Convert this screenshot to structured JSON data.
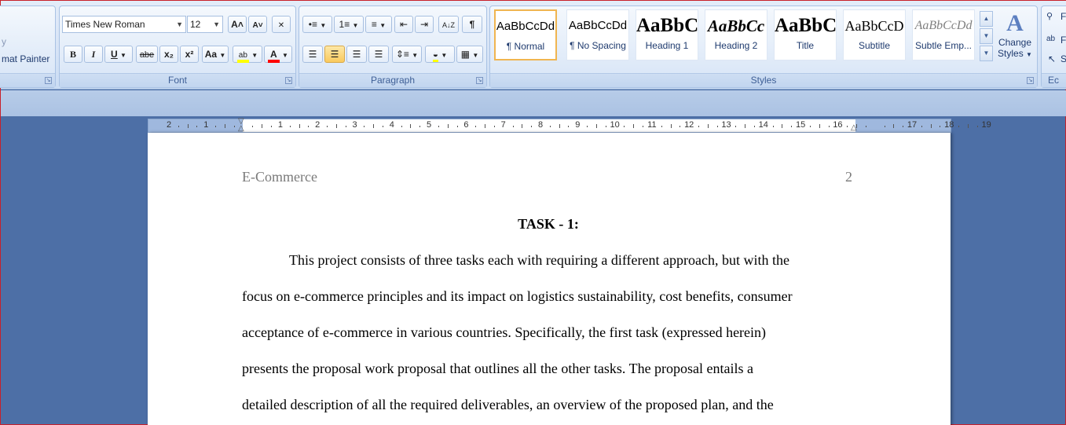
{
  "clipboard": {
    "format_painter_label": "mat Painter",
    "partial_label": "y"
  },
  "font": {
    "group_label": "Font",
    "font_name": "Times New Roman",
    "font_size": "12",
    "grow_font": "A˄",
    "shrink_font": "A˅",
    "clear_format": "✕",
    "bold": "B",
    "italic": "I",
    "underline": "U",
    "strikethrough": "abe",
    "subscript": "x₂",
    "superscript": "x²",
    "change_case": "Aa",
    "highlight": "ab",
    "font_color": "A",
    "highlight_color": "#ffff00",
    "font_color_value": "#ff0000"
  },
  "paragraph": {
    "group_label": "Paragraph",
    "show_marks": "¶",
    "sort": "A↓Z"
  },
  "styles": {
    "group_label": "Styles",
    "change_styles_label_1": "Change",
    "change_styles_label_2": "Styles",
    "tiles": [
      {
        "preview": "AaBbCcDd",
        "caption": "¶ Normal"
      },
      {
        "preview": "AaBbCcDd",
        "caption": "¶ No Spacing"
      },
      {
        "preview": "AaBbC",
        "caption": "Heading 1"
      },
      {
        "preview": "AaBbCc",
        "caption": "Heading 2"
      },
      {
        "preview": "AaBbC",
        "caption": "Title"
      },
      {
        "preview": "AaBbCcD",
        "caption": "Subtitle"
      },
      {
        "preview": "AaBbCcDd",
        "caption": "Subtle Emp..."
      }
    ]
  },
  "editing": {
    "partial_label": "Ec",
    "f_label": "F",
    "r_label": "F",
    "s_label": "S"
  },
  "ruler": {
    "numbers": [
      "2",
      "1",
      "",
      "1",
      "2",
      "3",
      "4",
      "5",
      "6",
      "7",
      "8",
      "9",
      "10",
      "11",
      "12",
      "13",
      "14",
      "15",
      "16",
      "",
      "17",
      "18",
      "19"
    ]
  },
  "document": {
    "header_title": "E-Commerce",
    "page_number": "2",
    "task_title": "TASK - 1:",
    "lines": [
      "This project consists of three tasks each with requiring a different approach, but with the",
      "focus on e-commerce principles and its impact on logistics sustainability, cost benefits, consumer",
      "acceptance of e-commerce in various countries. Specifically, the first task (expressed herein)",
      "presents the proposal work proposal that outlines all the other tasks. The proposal entails a",
      "detailed description of all the required deliverables, an overview of the proposed plan, and the"
    ]
  }
}
